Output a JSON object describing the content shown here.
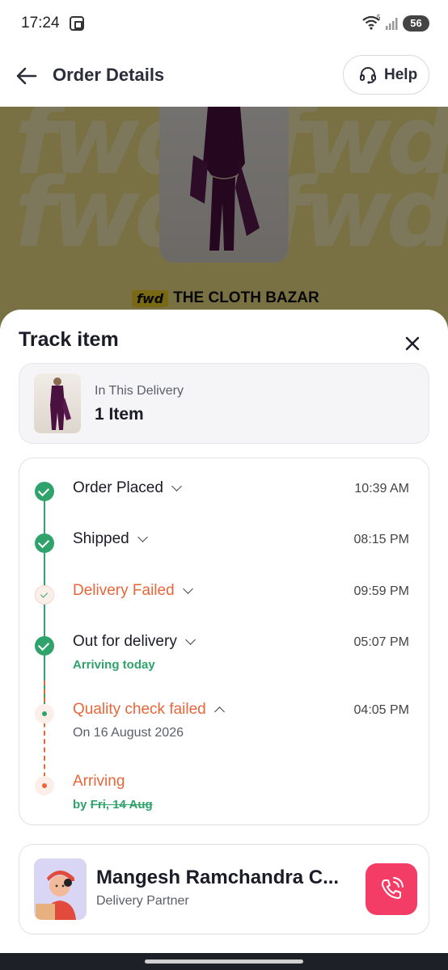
{
  "status_bar": {
    "time": "17:24",
    "battery": "56",
    "wifi_badge": "5"
  },
  "header": {
    "title": "Order Details",
    "help_label": "Help"
  },
  "hero": {
    "watermark": "fwd",
    "brand_logo": "fwd",
    "brand_name": "THE CLOTH BAZAR"
  },
  "sheet": {
    "title": "Track item",
    "delivery": {
      "label": "In This Delivery",
      "count": "1 Item"
    },
    "timeline": {
      "steps": [
        {
          "label": "Order Placed",
          "time": "10:39 AM"
        },
        {
          "label": "Shipped",
          "time": "08:15 PM"
        },
        {
          "label": "Delivery Failed",
          "time": "09:59 PM"
        },
        {
          "label": "Out for delivery",
          "time": "05:07 PM",
          "sub": "Arriving today"
        },
        {
          "label": "Quality check failed",
          "time": "04:05 PM",
          "sub": "On 16 August 2026"
        },
        {
          "label": "Arriving",
          "sub_prefix": "by",
          "sub_date": "Fri, 14 Aug"
        }
      ]
    },
    "partner": {
      "name": "Mangesh Ramchandra C...",
      "role": "Delivery Partner"
    }
  },
  "colors": {
    "success": "#2fa36b",
    "warning": "#e8663a",
    "call": "#f33d66",
    "brand_yellow": "#f5d229"
  },
  "icons": [
    "back-arrow-icon",
    "headset-icon",
    "close-icon",
    "phone-icon",
    "wifi-icon",
    "signal-icon",
    "screen-record-icon"
  ]
}
